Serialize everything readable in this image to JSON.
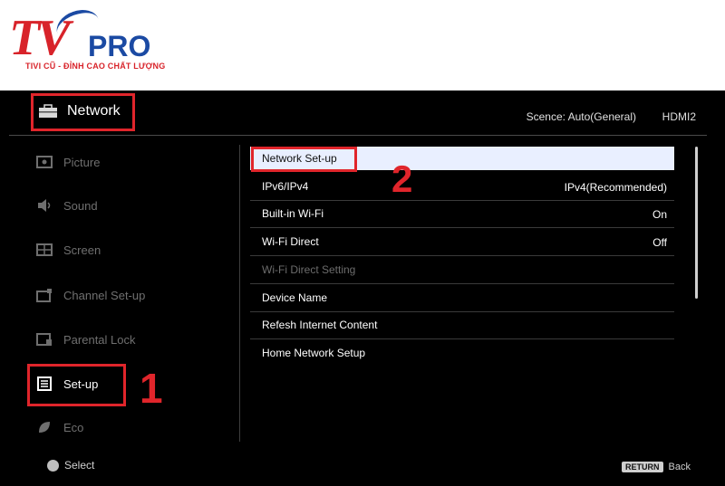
{
  "brand": {
    "logo_main": "TV",
    "logo_pro": "PRO",
    "tagline": "TIVI CŨ - ĐỈNH CAO CHẤT LƯỢNG"
  },
  "header": {
    "title": "Network",
    "scene": "Scence: Auto(General)",
    "input": "HDMI2"
  },
  "sidebar": {
    "items": [
      {
        "label": "Picture",
        "icon": "picture-icon"
      },
      {
        "label": "Sound",
        "icon": "speaker-icon"
      },
      {
        "label": "Screen",
        "icon": "screen-icon"
      },
      {
        "label": "Channel Set-up",
        "icon": "channel-icon"
      },
      {
        "label": "Parental Lock",
        "icon": "lock-icon"
      },
      {
        "label": "Set-up",
        "icon": "setup-icon"
      },
      {
        "label": "Eco",
        "icon": "eco-icon"
      }
    ]
  },
  "annotations": {
    "step1": "1",
    "step2": "2"
  },
  "menu": {
    "rows": [
      {
        "label": "Network Set-up",
        "value": ""
      },
      {
        "label": "IPv6/IPv4",
        "value": "IPv4(Recommended)"
      },
      {
        "label": "Built-in Wi-Fi",
        "value": "On"
      },
      {
        "label": "Wi-Fi Direct",
        "value": "Off"
      },
      {
        "label": "Wi-Fi Direct Setting",
        "value": ""
      },
      {
        "label": "Device Name",
        "value": ""
      },
      {
        "label": "Refesh Internet Content",
        "value": ""
      },
      {
        "label": "Home Network Setup",
        "value": ""
      }
    ]
  },
  "footer": {
    "select_label": "Select",
    "return_badge": "RETURN",
    "return_label": "Back"
  },
  "colors": {
    "highlight": "#e0252b",
    "selected_row": "#e9efff",
    "brand_red": "#d8232a",
    "brand_blue": "#1b4aa3"
  }
}
